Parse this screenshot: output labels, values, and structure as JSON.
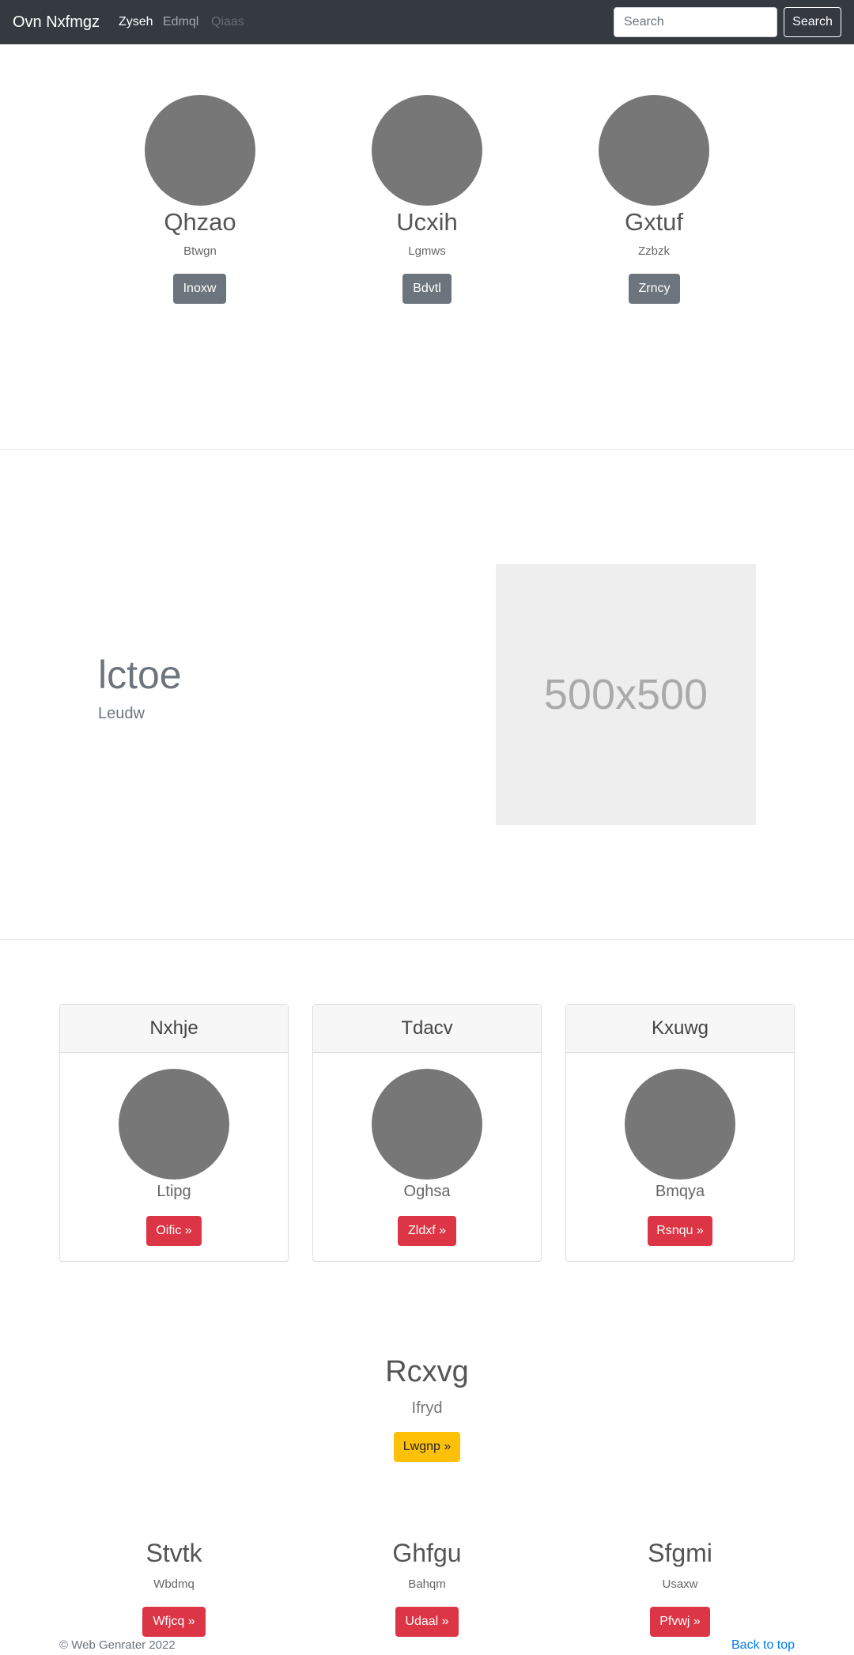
{
  "navbar": {
    "brand": "Ovn Nxfmgz",
    "links": [
      "Zyseh",
      "Edmql",
      "Qiaas"
    ],
    "search_placeholder": "Search",
    "search_button": "Search"
  },
  "team": [
    {
      "name": "Qhzao",
      "role": "Btwgn",
      "button": "Inoxw"
    },
    {
      "name": "Ucxih",
      "role": "Lgmws",
      "button": "Bdvtl"
    },
    {
      "name": "Gxtuf",
      "role": "Zzbzk",
      "button": "Zrncy"
    }
  ],
  "feature": {
    "title": "lctoe",
    "subtitle": "Leudw",
    "image_label": "500x500"
  },
  "cards": [
    {
      "title": "Nxhje",
      "subtitle": "Ltipg",
      "button": "Oific »"
    },
    {
      "title": "Tdacv",
      "subtitle": "Oghsa",
      "button": "Zldxf »"
    },
    {
      "title": "Kxuwg",
      "subtitle": "Bmqya",
      "button": "Rsnqu »"
    }
  ],
  "callout": {
    "title": "Rcxvg",
    "subtitle": "Ifryd",
    "button": "Lwgnp »"
  },
  "columns": [
    {
      "title": "Stvtk",
      "subtitle": "Wbdmq",
      "button": "Wfjcq »"
    },
    {
      "title": "Ghfgu",
      "subtitle": "Bahqm",
      "button": "Udaal »"
    },
    {
      "title": "Sfgmi",
      "subtitle": "Usaxw",
      "button": "Pfvwj »"
    }
  ],
  "footer": {
    "copyright": "© Web Genrater 2022",
    "back_to_top": "Back to top"
  },
  "colors": {
    "navbar": "#343a40",
    "danger": "#dc3545",
    "warning": "#ffc107",
    "secondary": "#6c757d",
    "link": "#007bff"
  }
}
